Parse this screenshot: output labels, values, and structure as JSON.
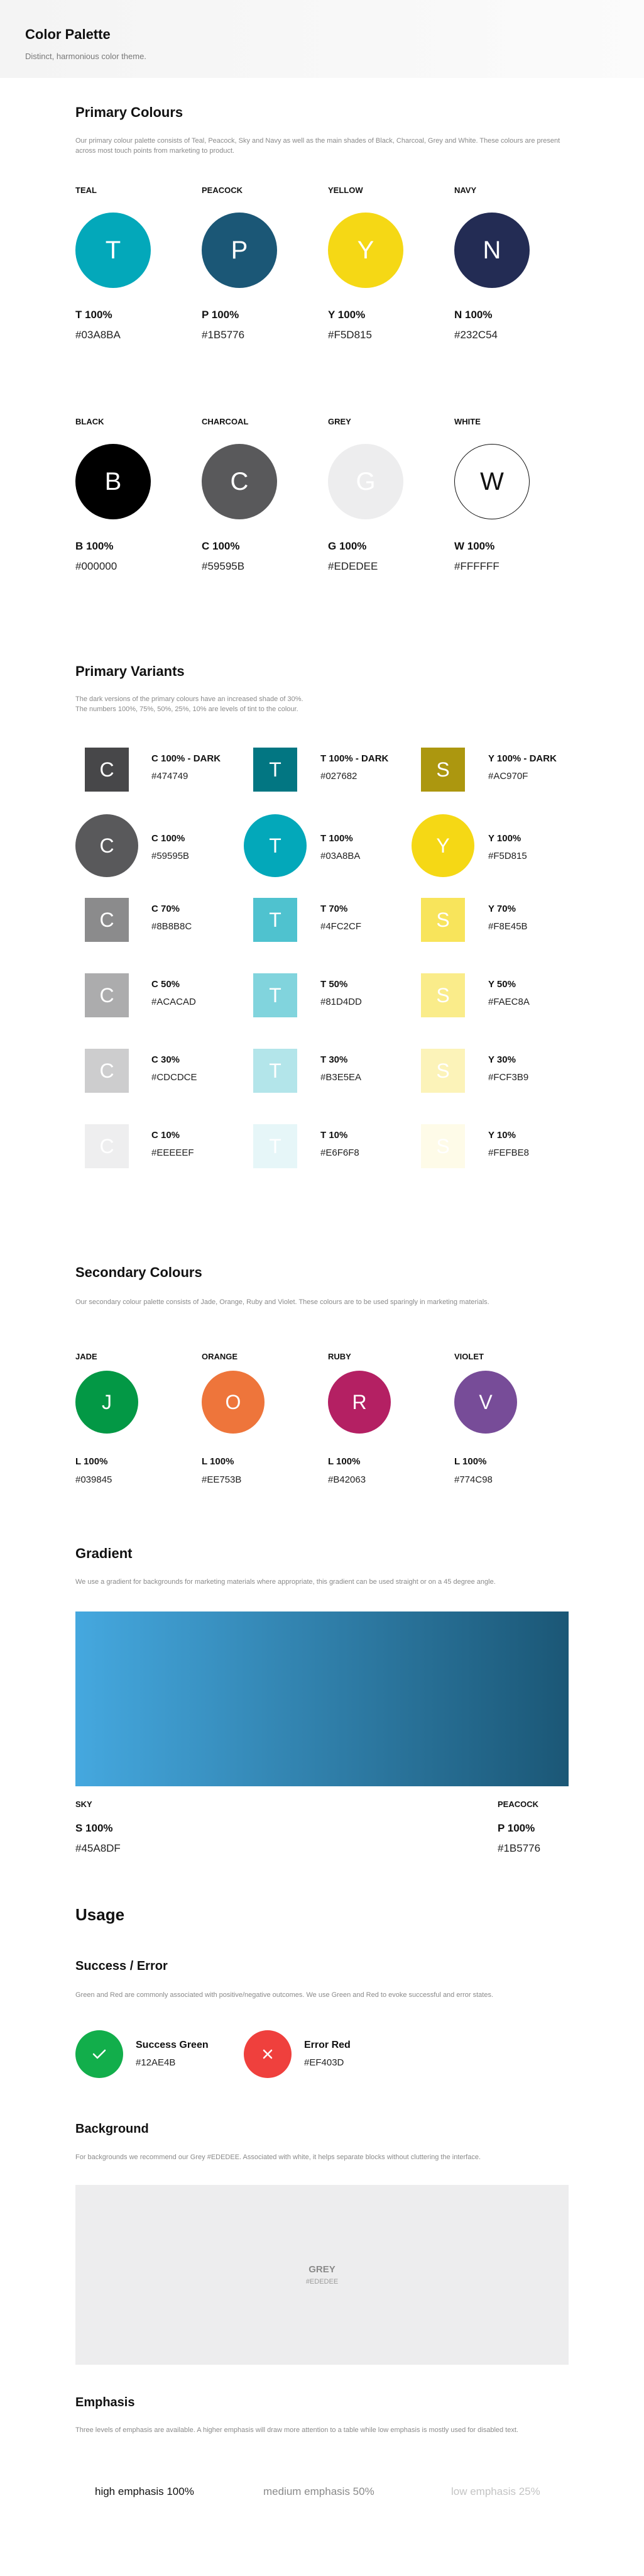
{
  "header": {
    "title": "Color Palette",
    "subtitle": "Distinct, harmonious color theme."
  },
  "primary": {
    "title": "Primary Colours",
    "description": "Our primary colour palette consists of Teal, Peacock, Sky and Navy as well as the main shades of Black, Charcoal, Grey and White. These colours are present across most touch points from marketing to product.",
    "row1": [
      {
        "name": "TEAL",
        "letter": "T",
        "pct": "T 100%",
        "hex": "#03A8BA",
        "color": "#03A8BA",
        "text_color": "#ffffff"
      },
      {
        "name": "PEACOCK",
        "letter": "P",
        "pct": "P 100%",
        "hex": "#1B5776",
        "color": "#1B5776",
        "text_color": "#ffffff"
      },
      {
        "name": "YELLOW",
        "letter": "Y",
        "pct": "Y 100%",
        "hex": "#F5D815",
        "color": "#F5D815",
        "text_color": "#ffffff"
      },
      {
        "name": "NAVY",
        "letter": "N",
        "pct": "N 100%",
        "hex": "#232C54",
        "color": "#232C54",
        "text_color": "#ffffff"
      }
    ],
    "row2": [
      {
        "name": "BLACK",
        "letter": "B",
        "pct": "B 100%",
        "hex": "#000000",
        "color": "#000000",
        "text_color": "#ffffff"
      },
      {
        "name": "CHARCOAL",
        "letter": "C",
        "pct": "C 100%",
        "hex": "#59595B",
        "color": "#59595B",
        "text_color": "#ffffff"
      },
      {
        "name": "GREY",
        "letter": "G",
        "pct": "G 100%",
        "hex": "#EDEDEE",
        "color": "#EDEDEE",
        "text_color": "#ffffff"
      },
      {
        "name": "WHITE",
        "letter": "W",
        "pct": "W 100%",
        "hex": "#FFFFFF",
        "color": "#FFFFFF",
        "text_color": "#111111"
      }
    ]
  },
  "variants": {
    "title": "Primary Variants",
    "description_1": "The dark versions of the primary colours have an increased shade of 30%.",
    "description_2": "The numbers 100%, 75%, 50%, 25%, 10% are levels of tint to the colour.",
    "rows": [
      [
        {
          "letter": "C",
          "label": "C 100% - DARK",
          "hex": "#474749",
          "color": "#474749",
          "shape": "square"
        },
        {
          "letter": "T",
          "label": "T 100% - DARK",
          "hex": "#027682",
          "color": "#027682",
          "shape": "square"
        },
        {
          "letter": "S",
          "label": "Y 100% - DARK",
          "hex": "#AC970F",
          "color": "#AC970F",
          "shape": "square"
        }
      ],
      [
        {
          "letter": "C",
          "label": "C 100%",
          "hex": "#59595B",
          "color": "#59595B",
          "shape": "circle"
        },
        {
          "letter": "T",
          "label": "T 100%",
          "hex": "#03A8BA",
          "color": "#03A8BA",
          "shape": "circle"
        },
        {
          "letter": "Y",
          "label": "Y 100%",
          "hex": "#F5D815",
          "color": "#F5D815",
          "shape": "circle"
        }
      ],
      [
        {
          "letter": "C",
          "label": "C 70%",
          "hex": "#8B8B8C",
          "color": "#8B8B8C",
          "shape": "square"
        },
        {
          "letter": "T",
          "label": "T 70%",
          "hex": "#4FC2CF",
          "color": "#4FC2CF",
          "shape": "square"
        },
        {
          "letter": "S",
          "label": "Y 70%",
          "hex": "#F8E45B",
          "color": "#F8E45B",
          "shape": "square"
        }
      ],
      [
        {
          "letter": "C",
          "label": "C 50%",
          "hex": "#ACACAD",
          "color": "#ACACAD",
          "shape": "square"
        },
        {
          "letter": "T",
          "label": "T 50%",
          "hex": "#81D4DD",
          "color": "#81D4DD",
          "shape": "square"
        },
        {
          "letter": "S",
          "label": "Y 50%",
          "hex": "#FAEC8A",
          "color": "#FAEC8A",
          "shape": "square"
        }
      ],
      [
        {
          "letter": "C",
          "label": "C 30%",
          "hex": "#CDCDCE",
          "color": "#CDCDCE",
          "shape": "square"
        },
        {
          "letter": "T",
          "label": "T 30%",
          "hex": "#B3E5EA",
          "color": "#B3E5EA",
          "shape": "square"
        },
        {
          "letter": "S",
          "label": "Y 30%",
          "hex": "#FCF3B9",
          "color": "#FCF3B9",
          "shape": "square"
        }
      ],
      [
        {
          "letter": "C",
          "label": "C 10%",
          "hex": "#EEEEEF",
          "color": "#EEEEEF",
          "shape": "square"
        },
        {
          "letter": "T",
          "label": "T 10%",
          "hex": "#E6F6F8",
          "color": "#E6F6F8",
          "shape": "square"
        },
        {
          "letter": "S",
          "label": "Y 10%",
          "hex": "#FEFBE8",
          "color": "#FEFBE8",
          "shape": "square"
        }
      ]
    ]
  },
  "secondary": {
    "title": "Secondary Colours",
    "description": "Our secondary colour palette consists of Jade, Orange, Ruby and Violet. These colours are to be used sparingly in marketing materials.",
    "items": [
      {
        "name": "JADE",
        "letter": "J",
        "pct": "L 100%",
        "hex": "#039845",
        "color": "#039845"
      },
      {
        "name": "ORANGE",
        "letter": "O",
        "pct": "L 100%",
        "hex": "#EE753B",
        "color": "#EE753B"
      },
      {
        "name": "RUBY",
        "letter": "R",
        "pct": "L 100%",
        "hex": "#B42063",
        "color": "#B42063"
      },
      {
        "name": "VIOLET",
        "letter": "V",
        "pct": "L 100%",
        "hex": "#774C98",
        "color": "#774C98"
      }
    ]
  },
  "gradient": {
    "title": "Gradient",
    "description": "We use a gradient for backgrounds for marketing materials where appropriate, this gradient can be used straight or on a 45 degree angle.",
    "start": {
      "name": "SKY",
      "pct": "S 100%",
      "hex": "#45A8DF",
      "color": "#45A8DF"
    },
    "end": {
      "name": "PEACOCK",
      "pct": "P 100%",
      "hex": "#1B5776",
      "color": "#1B5776"
    }
  },
  "usage": {
    "title": "Usage",
    "success_error": {
      "title": "Success / Error",
      "description": "Green and Red are commonly associated with positive/negative outcomes. We use Green and Red to evoke successful and error states.",
      "success": {
        "name": "Success Green",
        "hex": "#12AE4B",
        "color": "#12AE4B",
        "icon": "check-icon"
      },
      "error": {
        "name": "Error Red",
        "hex": "#EF403D",
        "color": "#EF403D",
        "icon": "close-icon"
      }
    },
    "background": {
      "title": "Background",
      "description": "For backgrounds we recommend our Grey #EDEDEE. Associated with white, it helps separate blocks without cluttering the interface.",
      "name": "GREY",
      "hex": "#EDEDEE"
    },
    "emphasis": {
      "title": "Emphasis",
      "description": "Three levels of emphasis are available. A higher emphasis will draw more attention to a table while low emphasis is mostly used for disabled text.",
      "levels": [
        {
          "label": "high emphasis 100%",
          "color": "#111111"
        },
        {
          "label": "medium emphasis 50%",
          "color": "#8a8a8a"
        },
        {
          "label": "low emphasis 25%",
          "color": "#c4c4c4"
        }
      ]
    }
  }
}
